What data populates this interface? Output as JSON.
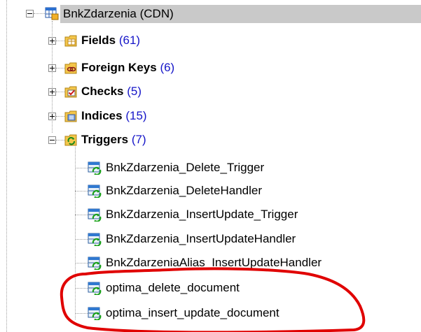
{
  "root": {
    "label": "BnkZdarzenia (CDN)"
  },
  "groups": [
    {
      "label": "Fields",
      "count": "(61)",
      "icon": "fields-icon",
      "expanded": false
    },
    {
      "label": "Foreign Keys",
      "count": "(6)",
      "icon": "foreign-keys-icon",
      "expanded": false
    },
    {
      "label": "Checks",
      "count": "(5)",
      "icon": "checks-icon",
      "expanded": false
    },
    {
      "label": "Indices",
      "count": "(15)",
      "icon": "indices-icon",
      "expanded": false
    },
    {
      "label": "Triggers",
      "count": "(7)",
      "icon": "triggers-icon",
      "expanded": true
    }
  ],
  "triggers": [
    "BnkZdarzenia_Delete_Trigger",
    "BnkZdarzenia_DeleteHandler",
    "BnkZdarzenia_InsertUpdate_Trigger",
    "BnkZdarzenia_InsertUpdateHandler",
    "BnkZdarzeniaAlias_InsertUpdateHandler",
    "optima_delete_document",
    "optima_insert_update_document"
  ],
  "colors": {
    "selection": "#c9c9c9",
    "count_text": "#1515c8",
    "highlight_ring": "#e00000"
  }
}
